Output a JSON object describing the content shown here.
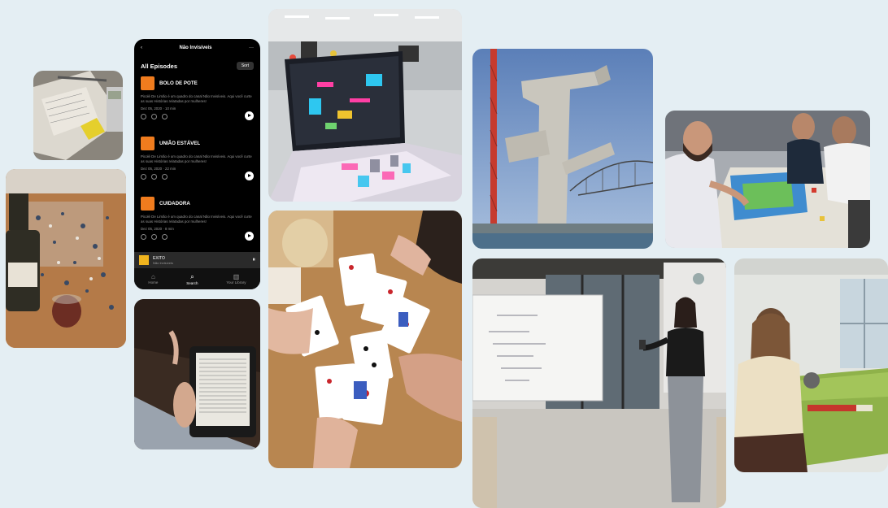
{
  "podcast": {
    "title": "Não Invisíveis",
    "more": "···",
    "back": "‹",
    "section": "All Episodes",
    "sort_label": "Sort",
    "episodes": [
      {
        "name": "BOLO DE POTE",
        "desc": "Picolé De Limão é um quadro do canal Não Invisíveis. Aqui você curte as suas Histórias relatadas por mulheres!",
        "date": "Dez 05, 2020 · 10 min"
      },
      {
        "name": "UNIÃO ESTÁVEL",
        "desc": "Picolé De Limão é um quadro do canal Não Invisíveis. Aqui você curte as suas Histórias relatadas por mulheres!",
        "date": "Dez 05, 2020 · 22 min"
      },
      {
        "name": "CUIDADORA",
        "desc": "Picolé De Limão é um quadro do canal Não Invisíveis. Aqui você curte as suas Histórias relatadas por mulheres!",
        "date": "Dez 05, 2020 · 8 min"
      }
    ],
    "mini_player": {
      "title": "EXITO",
      "subtitle": "Não Invisíveis",
      "pause": "⏸"
    },
    "tabs": [
      {
        "icon": "⌂",
        "label": "Home"
      },
      {
        "icon": "⌕",
        "label": "Search"
      },
      {
        "icon": "▥",
        "label": "Your Library"
      }
    ]
  }
}
